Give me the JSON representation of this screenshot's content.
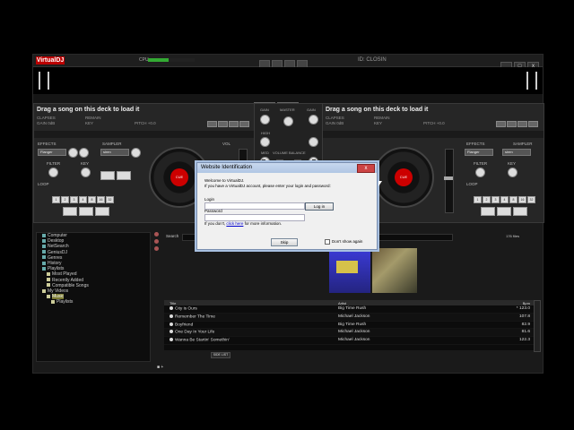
{
  "app": {
    "logo": "VirtualDJ",
    "cpu_label": "CPU",
    "user": "ID: CLOSIN",
    "cpu_percent": 0.45
  },
  "window_controls": [
    "_",
    "□",
    "x"
  ],
  "center_tabs": [
    "MIXER",
    "VIDEO",
    "EFFECTS"
  ],
  "deck_left": {
    "load_text": "Drag a song on this deck to load it",
    "clapses": "CLAPSES",
    "gain": "GAIN 0dB",
    "remain": "REMAIN",
    "key": "KEY",
    "pitch": "PITCH +0.0",
    "keysync": "KEY SYNC",
    "effects_label": "EFFECTS",
    "effect_value": "Flanger",
    "sampler_label": "SAMPLER",
    "sampler_value": "siren",
    "filter_label": "FILTER",
    "key_label": "KEY",
    "loop_label": "LOOP",
    "loop_buttons": [
      "1",
      "2",
      "3",
      "4",
      "8",
      "16",
      "32"
    ],
    "vol": "VOL",
    "platter_label": "CUE"
  },
  "deck_right": {
    "load_text": "Drag a song on this deck to load it",
    "clapses": "CLAPSES",
    "gain": "GAIN 0dB",
    "remain": "REMAIN",
    "key": "KEY",
    "pitch": "PITCH +0.0",
    "keysync": "KEY SYNC",
    "effects_label": "EFFECTS",
    "effect_value": "Flanger",
    "sampler_label": "SAMPLER",
    "sampler_value": "siren",
    "filter_label": "FILTER",
    "key_label": "KEY",
    "loop_label": "LOOP",
    "loop_buttons": [
      "1",
      "2",
      "3",
      "4",
      "8",
      "16",
      "32"
    ],
    "vol": "VOL",
    "platter_label": "CUE"
  },
  "mixer": {
    "gain": "GAIN",
    "master": "MASTER",
    "high": "HIGH",
    "med": "MED",
    "low": "LOW",
    "volume": "VOLUME",
    "balance": "BALANCE"
  },
  "browser": {
    "search_label": "Search",
    "search_value": "",
    "file_count": "176 files",
    "tree": [
      {
        "label": "Computer",
        "level": 1
      },
      {
        "label": "Desktop",
        "level": 1
      },
      {
        "label": "NetSearch",
        "level": 1
      },
      {
        "label": "GeniusDJ",
        "level": 1
      },
      {
        "label": "Genres",
        "level": 1
      },
      {
        "label": "History",
        "level": 1
      },
      {
        "label": "Playlists",
        "level": 1
      },
      {
        "label": "Most Played",
        "level": 2
      },
      {
        "label": "Recently Added",
        "level": 2
      },
      {
        "label": "Compatible Songs",
        "level": 2
      },
      {
        "label": "My Videos",
        "level": 1
      },
      {
        "label": "Music",
        "level": 2
      },
      {
        "label": "Playlists",
        "level": 3
      }
    ],
    "columns": {
      "title": "Title",
      "artist": "Artist",
      "bpm": "Bpm"
    },
    "songs": [
      {
        "title": "City is Ours",
        "artist": "Big Time Rush",
        "bpm": "* 123.0"
      },
      {
        "title": "Remember The Time",
        "artist": "Michael Jackson",
        "bpm": "107.8"
      },
      {
        "title": "Boyfriend",
        "artist": "Big Time Rush",
        "bpm": "82.9"
      },
      {
        "title": "One Day In Your Life",
        "artist": "Michael Jackson",
        "bpm": "81.6"
      },
      {
        "title": "Wanna Be Startin' Somethin'",
        "artist": "Michael Jackson",
        "bpm": "122.3"
      }
    ],
    "side_list_label": "SIDE LIST"
  },
  "dialog": {
    "title": "Website Identification",
    "close": "x",
    "welcome": "Welcome to VirtualDJ.",
    "instruction": "If you have a VirtualDJ account, please enter your login and password:",
    "login_label": "Login",
    "password_label": "Password",
    "login_value": "",
    "password_value": "",
    "login_button": "Log in",
    "no_account_prefix": "If you don't,",
    "link": "click here",
    "no_account_suffix": "for more information.",
    "skip_button": "Skip",
    "dont_show": "Don't show again"
  }
}
